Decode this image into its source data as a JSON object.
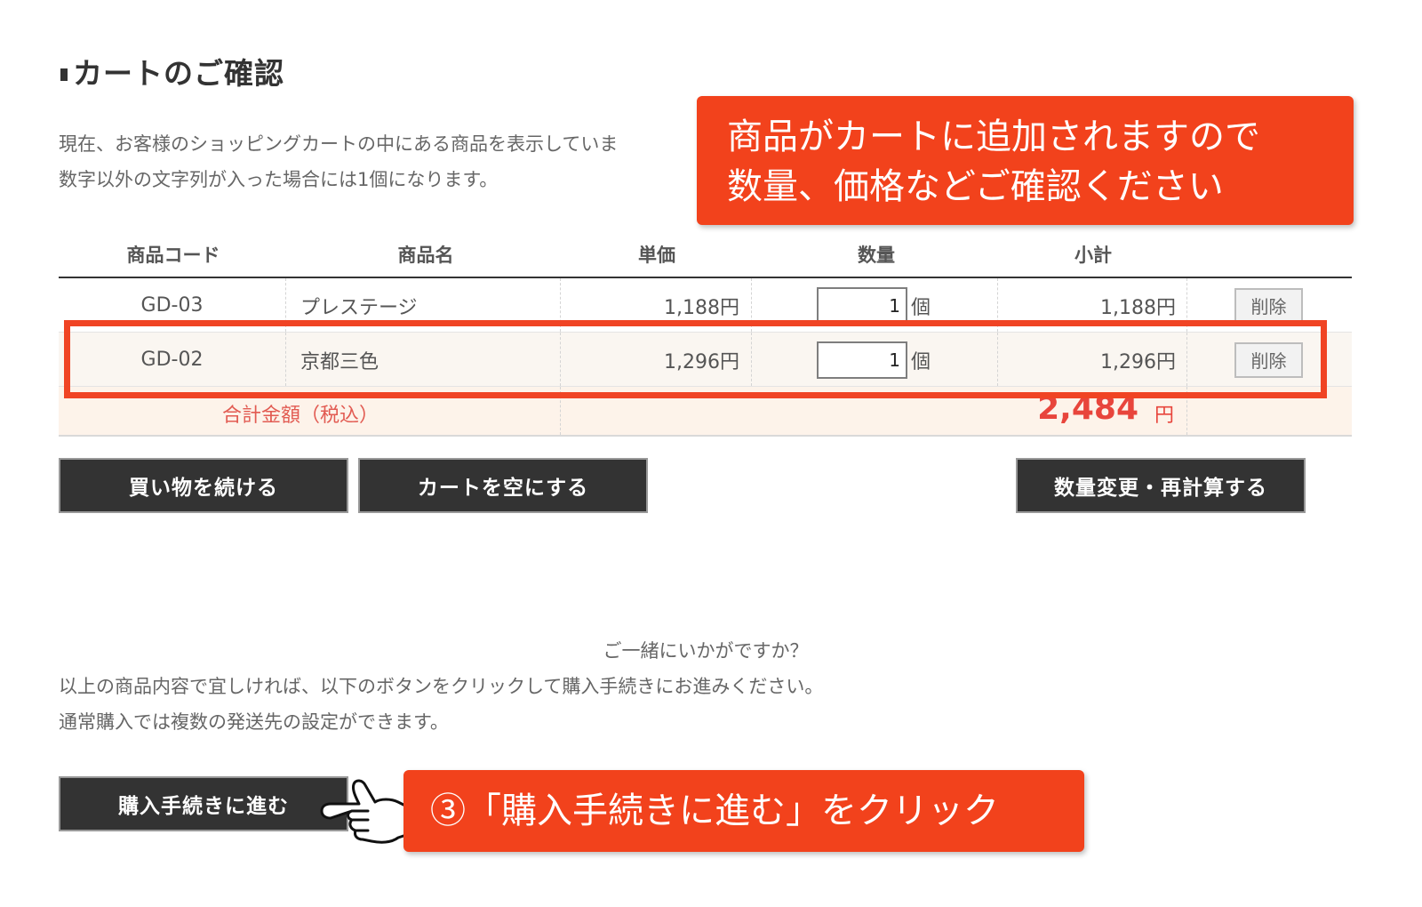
{
  "page": {
    "title": "カートのご確認"
  },
  "intro": {
    "line1": "現在、お客様のショッピングカートの中にある商品を表示していま",
    "line2": "数字以外の文字列が入った場合には1個になります。"
  },
  "table": {
    "headers": [
      "商品コード",
      "商品名",
      "単価",
      "数量",
      "小計"
    ],
    "rows": [
      {
        "code": "GD-03",
        "name": "プレステージ",
        "price": "1,188円",
        "qty": "1",
        "unit": "個",
        "subtotal": "1,188円",
        "delete": "削除"
      },
      {
        "code": "GD-02",
        "name": "京都三色",
        "price": "1,296円",
        "qty": "1",
        "unit": "個",
        "subtotal": "1,296円",
        "delete": "削除"
      }
    ],
    "total": {
      "label": "合計金額（税込）",
      "amount": "2,484",
      "unit": "円"
    }
  },
  "buttons": {
    "continue": "買い物を続ける",
    "empty": "カートを空にする",
    "recalc": "数量変更・再計算する",
    "checkout": "購入手続きに進む"
  },
  "recommend": "ご一緒にいかがですか？",
  "notes": {
    "line1": "以上の商品内容で宜しければ、以下のボタンをクリックして購入手続きにお進みください。",
    "line2": "通常購入では複数の発送先の設定ができます。"
  },
  "callouts": {
    "top_line1": "商品がカートに追加されますので",
    "top_line2": "数量、価格などご確認ください",
    "bottom": "③「購入手続きに進む」をクリック"
  },
  "colors": {
    "callout": "#f2421c",
    "highlight": "#f04424",
    "button": "#333333",
    "total": "#e8453c"
  },
  "icons": {
    "pointer": "pointing-hand-icon",
    "title_mark": "square-bullet-icon"
  }
}
